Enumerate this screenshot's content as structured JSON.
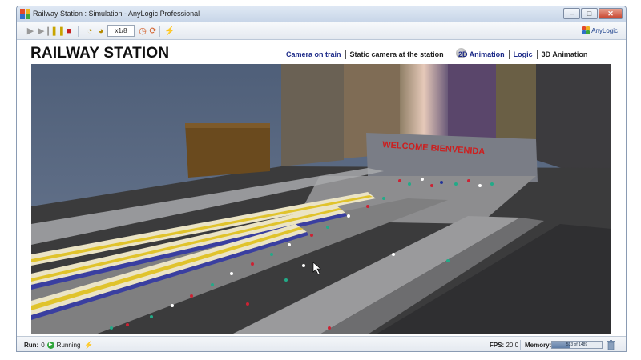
{
  "window": {
    "title": "Railway Station : Simulation - AnyLogic Professional",
    "controls": {
      "minimize": "–",
      "maximize": "□",
      "close": "✕"
    }
  },
  "toolbar": {
    "speed": "x1/8",
    "brand": "AnyLogic",
    "icons": [
      "play-icon",
      "step-icon",
      "pause-icon",
      "stop-icon",
      "slow-down-icon",
      "speed-up-icon",
      "virtual-time-icon",
      "real-time-icon",
      "experiment-icon"
    ]
  },
  "model": {
    "heading": "RAILWAY STATION",
    "nav_cameras": [
      "Camera on train",
      "Static camera at the station"
    ],
    "nav_views": [
      "2D Animation",
      "Logic",
      "3D Animation"
    ]
  },
  "scene": {
    "sign": "WELCOME   BIENVENIDA",
    "colors": {
      "sky": "#5b6a83",
      "ground": "#3a3a3b",
      "platform": "#8c8c8c",
      "train_body": "#ebe4c5",
      "train_stripe": "#e0c32c",
      "sign_text": "#cc1f1f"
    }
  },
  "status": {
    "run_label": "Run:",
    "run_value": "0",
    "state": "Running",
    "fps_label": "FPS:",
    "fps_value": "20.0",
    "memory_label": "Memory:",
    "memory_text": "533 of 1489",
    "memory_fraction": 0.36
  }
}
